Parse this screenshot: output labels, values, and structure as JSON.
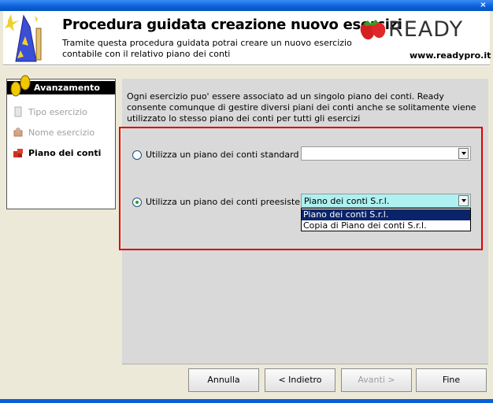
{
  "window": {
    "close_glyph": "×"
  },
  "header": {
    "title": "Procedura guidata creazione nuovo esercizi",
    "description": "Tramite questa procedura guidata potrai creare un nuovo esercizio contabile con il relativo piano dei conti",
    "logo_text": "READY",
    "website": "www.readypro.it"
  },
  "nav": {
    "heading": "Avanzamento",
    "items": [
      {
        "label": "Tipo esercizio",
        "state": "disabled",
        "icon": "document-icon"
      },
      {
        "label": "Nome esercizio",
        "state": "disabled",
        "icon": "gear-icon"
      },
      {
        "label": "Piano dei conti",
        "state": "active",
        "icon": "puzzle-icon"
      }
    ]
  },
  "main": {
    "intro": "Ogni esercizio puo' essere associato ad un singolo piano dei conti. Ready consente comunque di gestire diversi piani dei conti anche se solitamente viene utilizzato lo stesso piano dei conti per tutti gli esercizi",
    "option_standard": {
      "label": "Utilizza un piano dei conti standard",
      "checked": false,
      "combo_value": ""
    },
    "option_existing": {
      "label": "Utilizza un piano dei conti preesistente",
      "checked": true,
      "combo_value": "Piano dei conti S.r.l."
    },
    "dropdown_options": [
      "Piano dei conti S.r.l.",
      "Copia di Piano dei conti S.r.l."
    ]
  },
  "footer": {
    "cancel": "Annulla",
    "back": "< Indietro",
    "next": "Avanti >",
    "finish": "Fine"
  },
  "colors": {
    "accent": "#0a246a",
    "highlight_frame": "#dd0000",
    "radio_dot": "#21a121"
  }
}
